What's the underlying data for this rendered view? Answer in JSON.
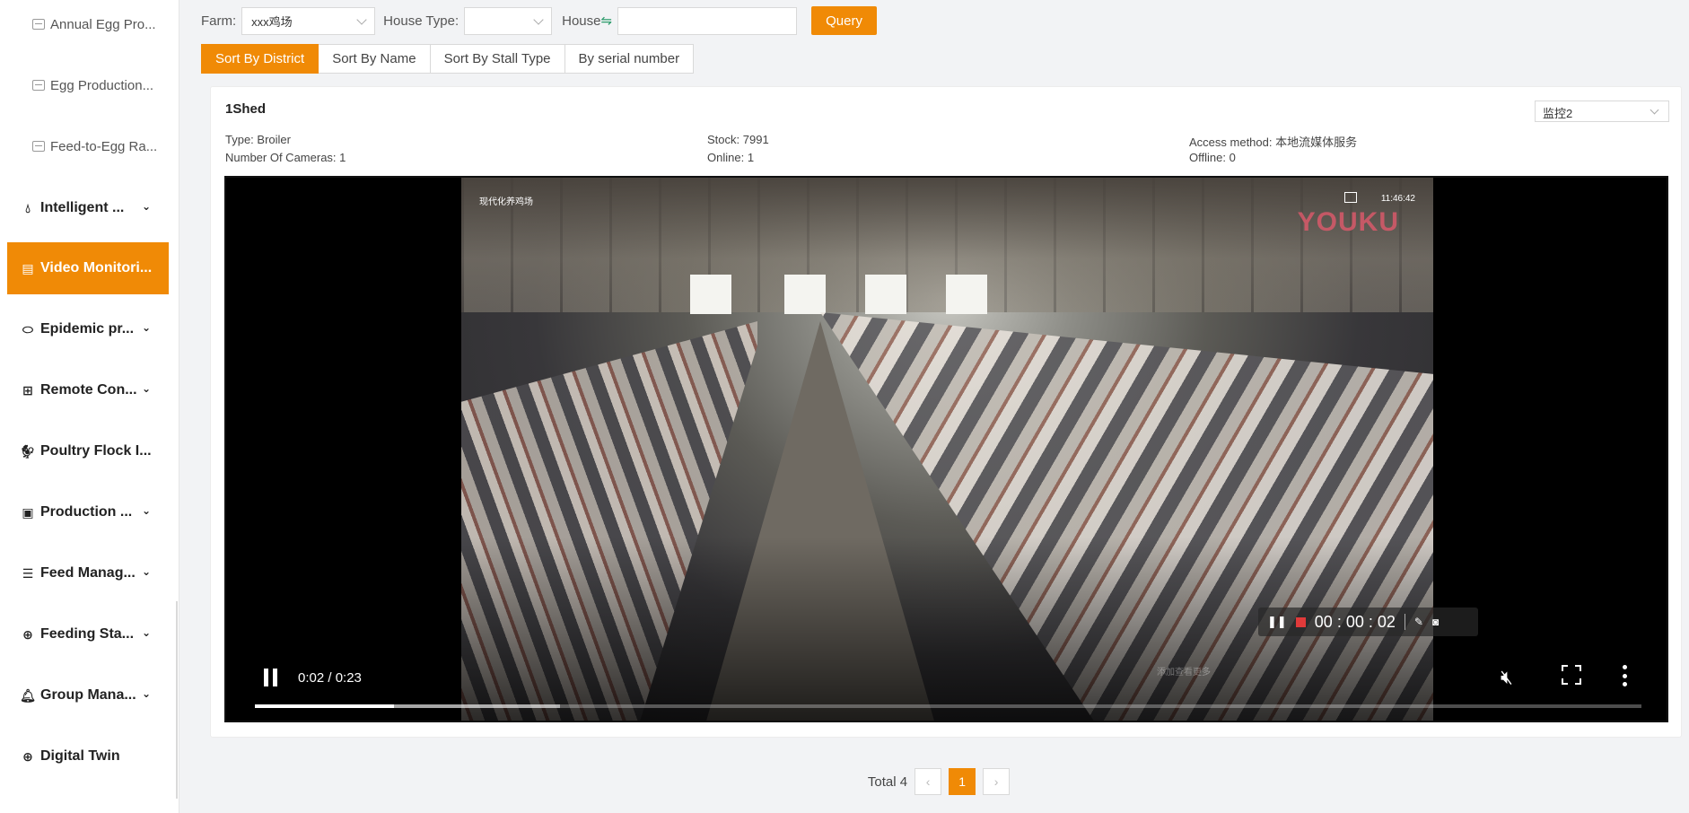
{
  "sidebar": {
    "sub_items": [
      {
        "label": "Annual Egg Pro...",
        "icon": "report-icon"
      },
      {
        "label": "Egg Production...",
        "icon": "report-icon"
      },
      {
        "label": "Feed-to-Egg Ra...",
        "icon": "report-icon"
      }
    ],
    "menu_items": [
      {
        "label": "Intelligent ...",
        "icon": "droplet-icon",
        "has_chevron": true
      },
      {
        "label": "Video Monitori...",
        "icon": "video-monitor-icon",
        "active": true
      },
      {
        "label": "Epidemic pr...",
        "icon": "pill-icon",
        "has_chevron": true
      },
      {
        "label": "Remote Con...",
        "icon": "network-icon",
        "has_chevron": true
      },
      {
        "label": "Poultry Flock I...",
        "icon": "chicken-icon",
        "has_chevron": false
      },
      {
        "label": "Production ...",
        "icon": "document-icon",
        "has_chevron": true
      },
      {
        "label": "Feed Manag...",
        "icon": "list-icon",
        "has_chevron": true
      },
      {
        "label": "Feeding Sta...",
        "icon": "globe-icon",
        "has_chevron": true
      },
      {
        "label": "Group Mana...",
        "icon": "bell-icon",
        "has_chevron": true
      },
      {
        "label": "Digital Twin",
        "icon": "globe-icon",
        "has_chevron": false
      }
    ]
  },
  "filters": {
    "farm_label": "Farm:",
    "farm_value": "xxx鸡场",
    "house_type_label": "House Type:",
    "house_type_value": "",
    "house_label": "House",
    "house_swap_glyph": "⇋",
    "house_value": "",
    "query_label": "Query"
  },
  "tabs": [
    {
      "label": "Sort By District",
      "active": true
    },
    {
      "label": "Sort By Name",
      "active": false
    },
    {
      "label": "Sort By Stall Type",
      "active": false
    },
    {
      "label": "By serial number",
      "active": false
    }
  ],
  "card": {
    "title": "1Shed",
    "monitor_select": "监控2",
    "type_label": "Type:",
    "type_value": "Broiler",
    "cameras_label": "Number Of Cameras:",
    "cameras_value": "1",
    "stock_label": "Stock:",
    "stock_value": "7991",
    "online_label": "Online:",
    "online_value": "1",
    "access_label": "Access method:",
    "access_value": "本地流媒体服务",
    "offline_label": "Offline:",
    "offline_value": "0"
  },
  "video": {
    "overlay_label": "现代化养鸡场",
    "overlay_time": "11:46:42",
    "brand_watermark": "YOUKU",
    "record_time": "00 : 00 : 02",
    "center_watermark": "添加查看更多",
    "time_display": "0:02 / 0:23",
    "played_fraction": 0.1,
    "buffered_fraction": 0.22
  },
  "pagination": {
    "total_label": "Total 4",
    "prev": "‹",
    "current": "1",
    "next": "›"
  },
  "colors": {
    "accent": "#f08a06"
  }
}
